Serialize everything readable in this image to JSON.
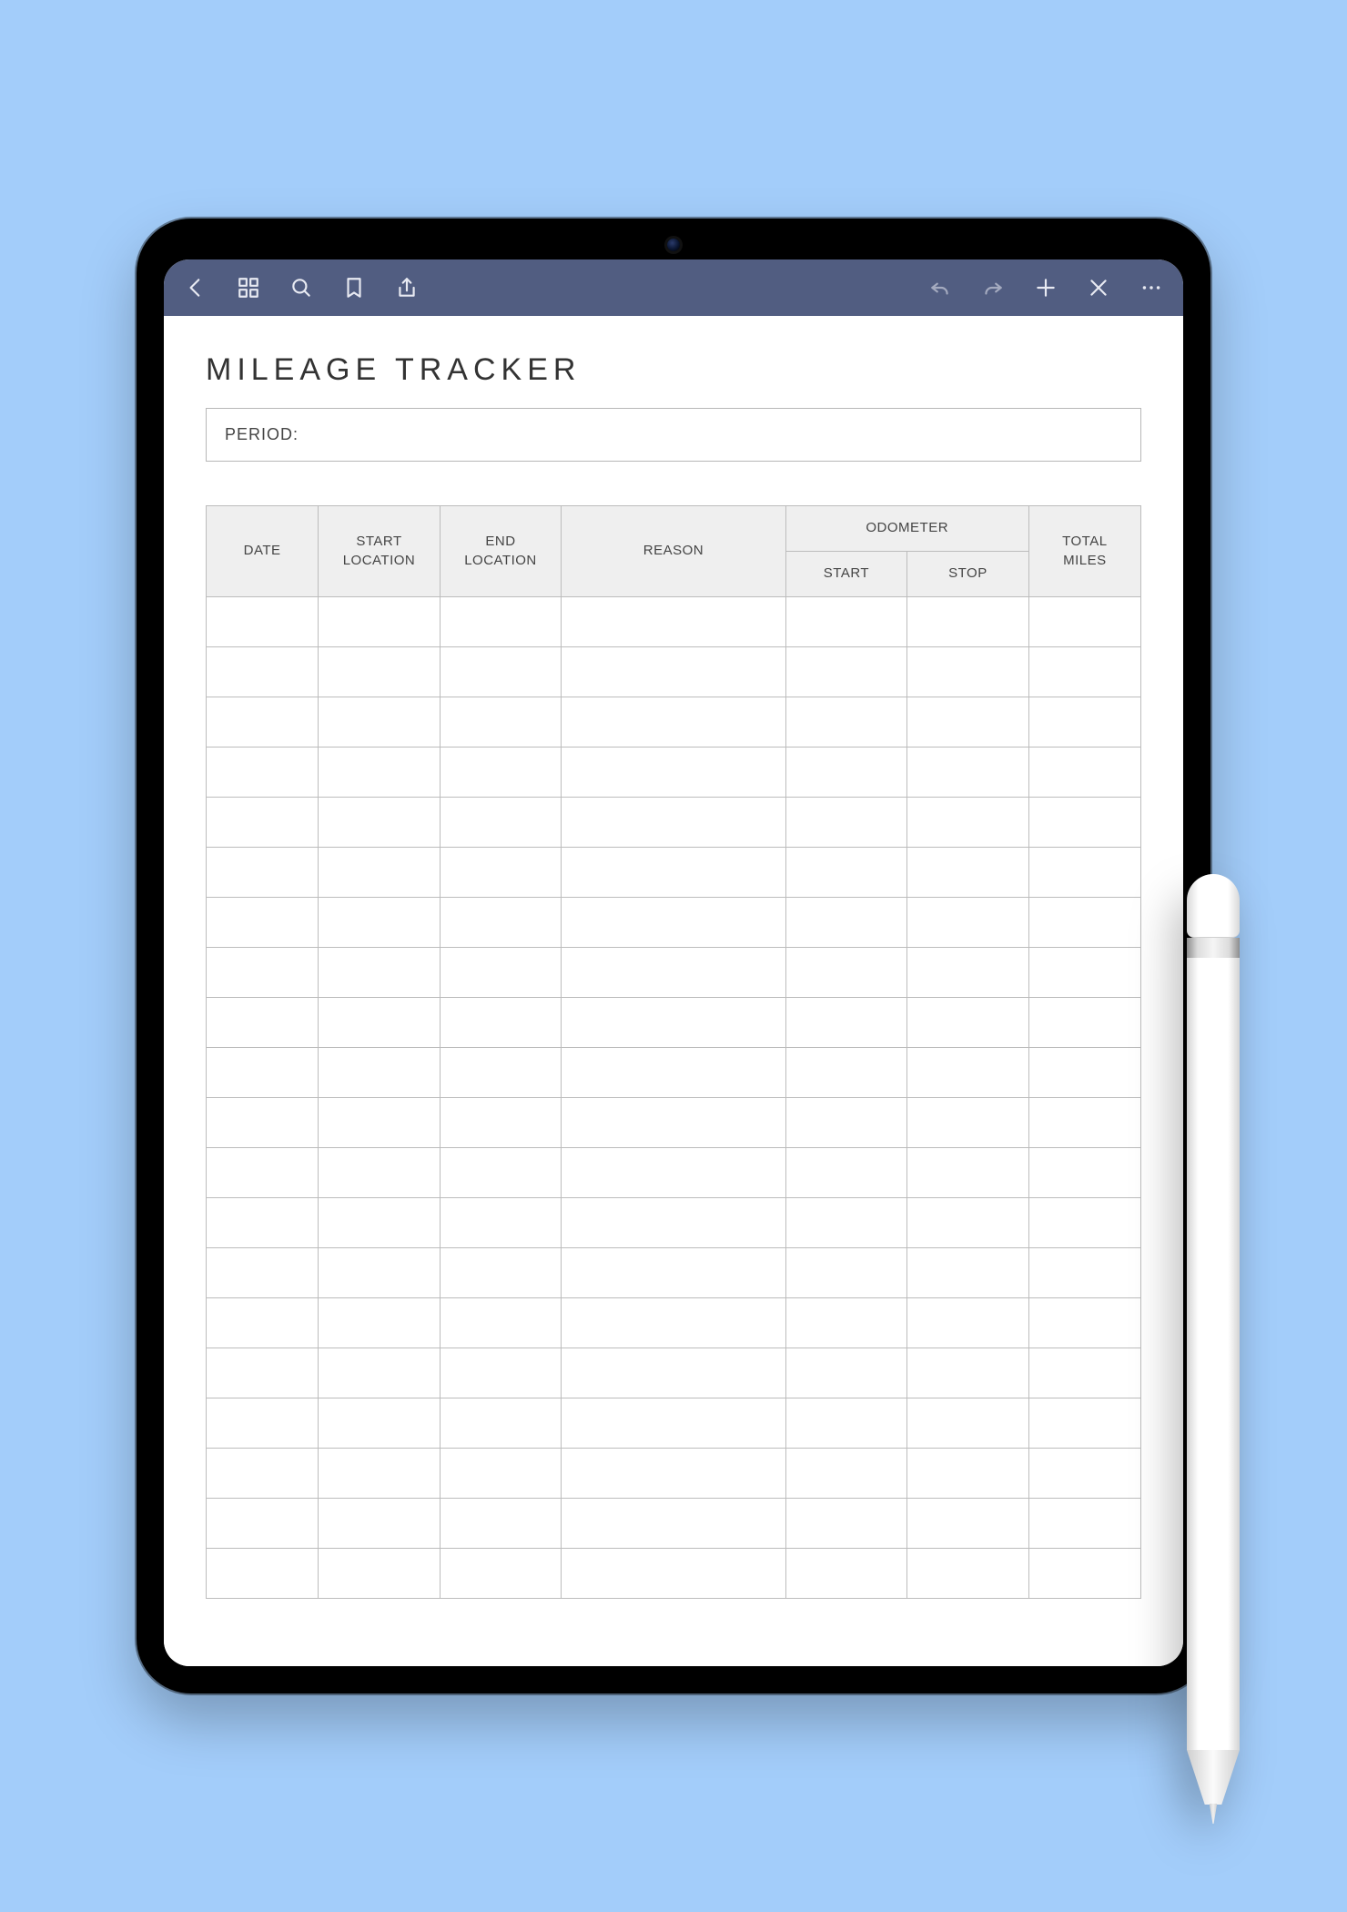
{
  "toolbar": {
    "icons": {
      "back": "back-icon",
      "grid": "grid-icon",
      "search": "search-icon",
      "bookmark": "bookmark-icon",
      "share": "share-icon",
      "undo": "undo-icon",
      "redo": "redo-icon",
      "add": "plus-icon",
      "close": "close-icon",
      "more": "more-icon"
    }
  },
  "document": {
    "title": "MILEAGE TRACKER",
    "period_label": "PERIOD:",
    "columns": {
      "date": "DATE",
      "start_location": "START LOCATION",
      "end_location": "END LOCATION",
      "reason": "REASON",
      "odometer": "ODOMETER",
      "odometer_start": "START",
      "odometer_stop": "STOP",
      "total_miles": "TOTAL MILES"
    },
    "row_count": 20,
    "rows": [
      {
        "date": "",
        "start_location": "",
        "end_location": "",
        "reason": "",
        "odo_start": "",
        "odo_stop": "",
        "total_miles": ""
      },
      {
        "date": "",
        "start_location": "",
        "end_location": "",
        "reason": "",
        "odo_start": "",
        "odo_stop": "",
        "total_miles": ""
      },
      {
        "date": "",
        "start_location": "",
        "end_location": "",
        "reason": "",
        "odo_start": "",
        "odo_stop": "",
        "total_miles": ""
      },
      {
        "date": "",
        "start_location": "",
        "end_location": "",
        "reason": "",
        "odo_start": "",
        "odo_stop": "",
        "total_miles": ""
      },
      {
        "date": "",
        "start_location": "",
        "end_location": "",
        "reason": "",
        "odo_start": "",
        "odo_stop": "",
        "total_miles": ""
      },
      {
        "date": "",
        "start_location": "",
        "end_location": "",
        "reason": "",
        "odo_start": "",
        "odo_stop": "",
        "total_miles": ""
      },
      {
        "date": "",
        "start_location": "",
        "end_location": "",
        "reason": "",
        "odo_start": "",
        "odo_stop": "",
        "total_miles": ""
      },
      {
        "date": "",
        "start_location": "",
        "end_location": "",
        "reason": "",
        "odo_start": "",
        "odo_stop": "",
        "total_miles": ""
      },
      {
        "date": "",
        "start_location": "",
        "end_location": "",
        "reason": "",
        "odo_start": "",
        "odo_stop": "",
        "total_miles": ""
      },
      {
        "date": "",
        "start_location": "",
        "end_location": "",
        "reason": "",
        "odo_start": "",
        "odo_stop": "",
        "total_miles": ""
      },
      {
        "date": "",
        "start_location": "",
        "end_location": "",
        "reason": "",
        "odo_start": "",
        "odo_stop": "",
        "total_miles": ""
      },
      {
        "date": "",
        "start_location": "",
        "end_location": "",
        "reason": "",
        "odo_start": "",
        "odo_stop": "",
        "total_miles": ""
      },
      {
        "date": "",
        "start_location": "",
        "end_location": "",
        "reason": "",
        "odo_start": "",
        "odo_stop": "",
        "total_miles": ""
      },
      {
        "date": "",
        "start_location": "",
        "end_location": "",
        "reason": "",
        "odo_start": "",
        "odo_stop": "",
        "total_miles": ""
      },
      {
        "date": "",
        "start_location": "",
        "end_location": "",
        "reason": "",
        "odo_start": "",
        "odo_stop": "",
        "total_miles": ""
      },
      {
        "date": "",
        "start_location": "",
        "end_location": "",
        "reason": "",
        "odo_start": "",
        "odo_stop": "",
        "total_miles": ""
      },
      {
        "date": "",
        "start_location": "",
        "end_location": "",
        "reason": "",
        "odo_start": "",
        "odo_stop": "",
        "total_miles": ""
      },
      {
        "date": "",
        "start_location": "",
        "end_location": "",
        "reason": "",
        "odo_start": "",
        "odo_stop": "",
        "total_miles": ""
      },
      {
        "date": "",
        "start_location": "",
        "end_location": "",
        "reason": "",
        "odo_start": "",
        "odo_stop": "",
        "total_miles": ""
      },
      {
        "date": "",
        "start_location": "",
        "end_location": "",
        "reason": "",
        "odo_start": "",
        "odo_stop": "",
        "total_miles": ""
      }
    ]
  }
}
